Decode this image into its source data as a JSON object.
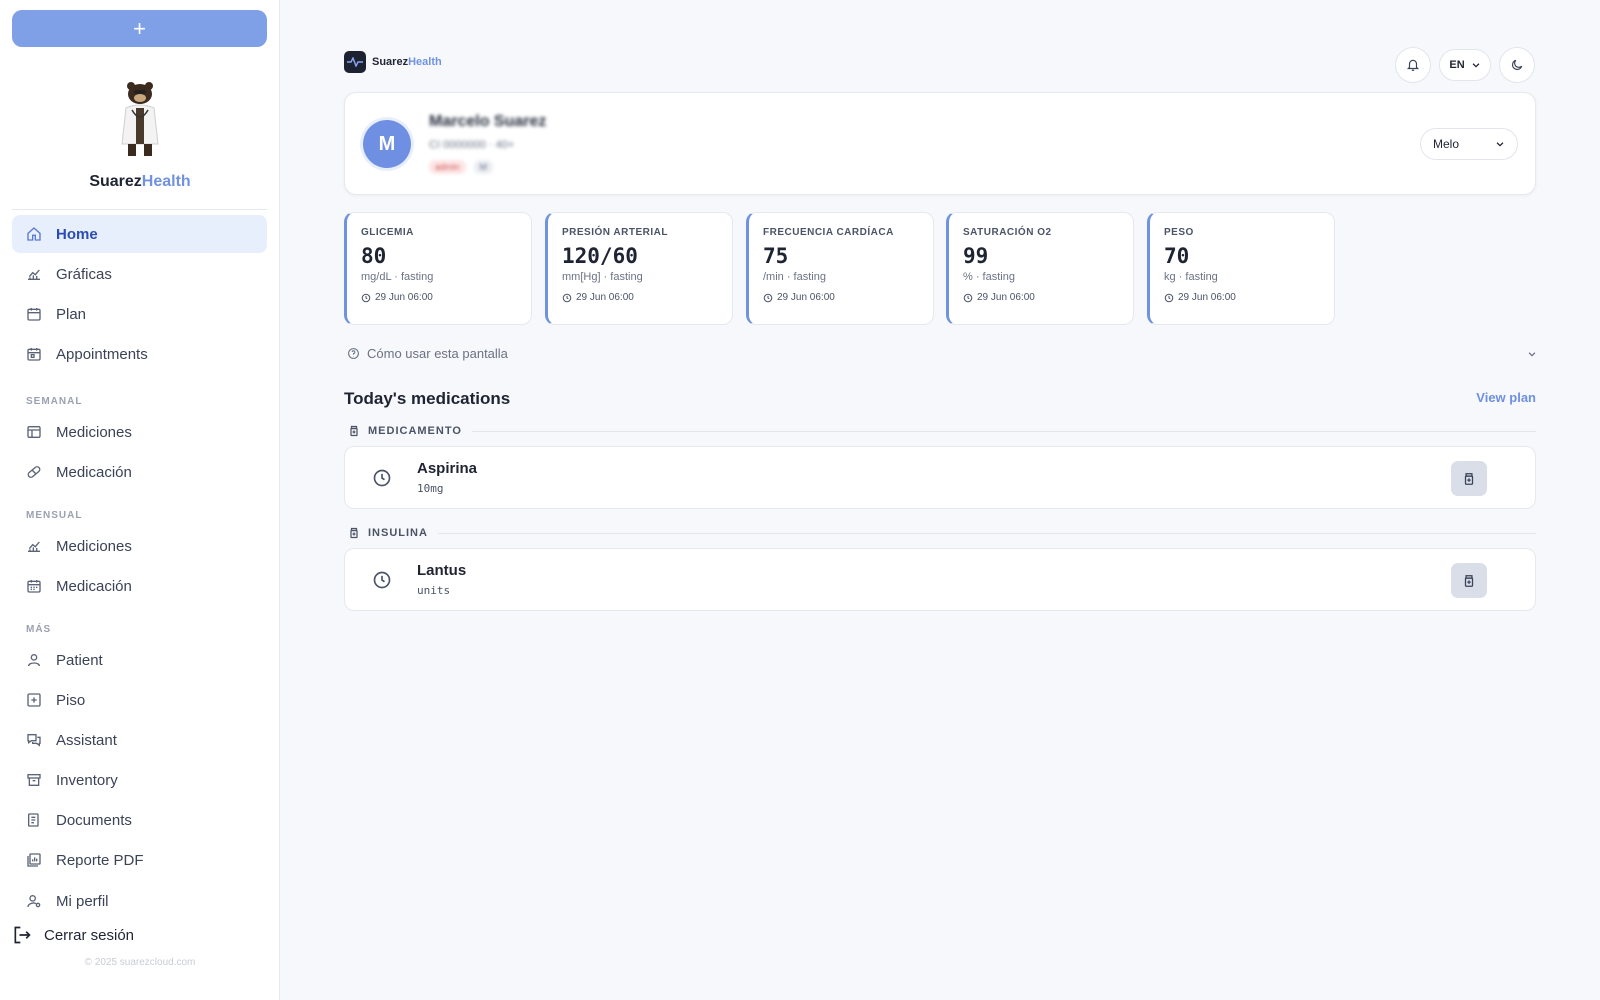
{
  "sidebar": {
    "new_button": "+",
    "brand": {
      "part1": "Suarez",
      "part2": "Health"
    },
    "items_primary": [
      {
        "label": "Home",
        "icon": "home-icon"
      },
      {
        "label": "Gráficas",
        "icon": "chart-icon"
      },
      {
        "label": "Plan",
        "icon": "calendar-icon"
      },
      {
        "label": "Appointments",
        "icon": "calendar-check-icon"
      }
    ],
    "section_semanal": "SEMANAL",
    "items_semanal": [
      {
        "label": "Mediciones",
        "icon": "table-icon"
      },
      {
        "label": "Medicación",
        "icon": "pill-icon"
      }
    ],
    "section_mensual": "MENSUAL",
    "items_mensual": [
      {
        "label": "Mediciones",
        "icon": "chart-icon"
      },
      {
        "label": "Medicación",
        "icon": "calendar-icon"
      }
    ],
    "section_mas": "MÁS",
    "items_mas": [
      {
        "label": "Patient",
        "icon": "user-icon"
      },
      {
        "label": "Piso",
        "icon": "plus-square-icon"
      },
      {
        "label": "Assistant",
        "icon": "chat-icon"
      },
      {
        "label": "Inventory",
        "icon": "archive-icon"
      },
      {
        "label": "Documents",
        "icon": "document-icon"
      },
      {
        "label": "Reporte PDF",
        "icon": "report-icon"
      },
      {
        "label": "Mi perfil",
        "icon": "user-settings-icon"
      }
    ],
    "logout": "Cerrar sesión",
    "copyright": "© 2025 suarezcloud.com"
  },
  "header": {
    "logo": {
      "part1": "Suarez",
      "part2": "Health"
    },
    "language": "EN"
  },
  "patient": {
    "initial": "M",
    "name": "Marcelo Suarez",
    "subtitle": "CI 0000000 · 40+",
    "tags": [
      "admin",
      "M"
    ],
    "selector_value": "Melo"
  },
  "vitals": [
    {
      "label": "GLICEMIA",
      "value": "80",
      "unit": "mg/dL · fasting",
      "time": "29 Jun 06:00"
    },
    {
      "label": "PRESIÓN ARTERIAL",
      "value": "120/60",
      "unit": "mm[Hg] · fasting",
      "time": "29 Jun 06:00"
    },
    {
      "label": "FRECUENCIA CARDÍACA",
      "value": "75",
      "unit": "/min · fasting",
      "time": "29 Jun 06:00"
    },
    {
      "label": "SATURACIÓN O2",
      "value": "99",
      "unit": "% · fasting",
      "time": "29 Jun 06:00"
    },
    {
      "label": "PESO",
      "value": "70",
      "unit": "kg · fasting",
      "time": "29 Jun 06:00"
    }
  ],
  "howto": "Cómo usar esta pantalla",
  "medications": {
    "title": "Today's medications",
    "view_plan": "View plan",
    "groups": [
      {
        "label": "MEDICAMENTO",
        "items": [
          {
            "name": "Aspirina",
            "dose": "10mg"
          }
        ]
      },
      {
        "label": "INSULINA",
        "items": [
          {
            "name": "Lantus",
            "dose": "units"
          }
        ]
      }
    ]
  },
  "colors": {
    "accent": "#7093e0",
    "sidebar_active_bg": "#e8effc",
    "avatar": "#6f8fe2"
  }
}
